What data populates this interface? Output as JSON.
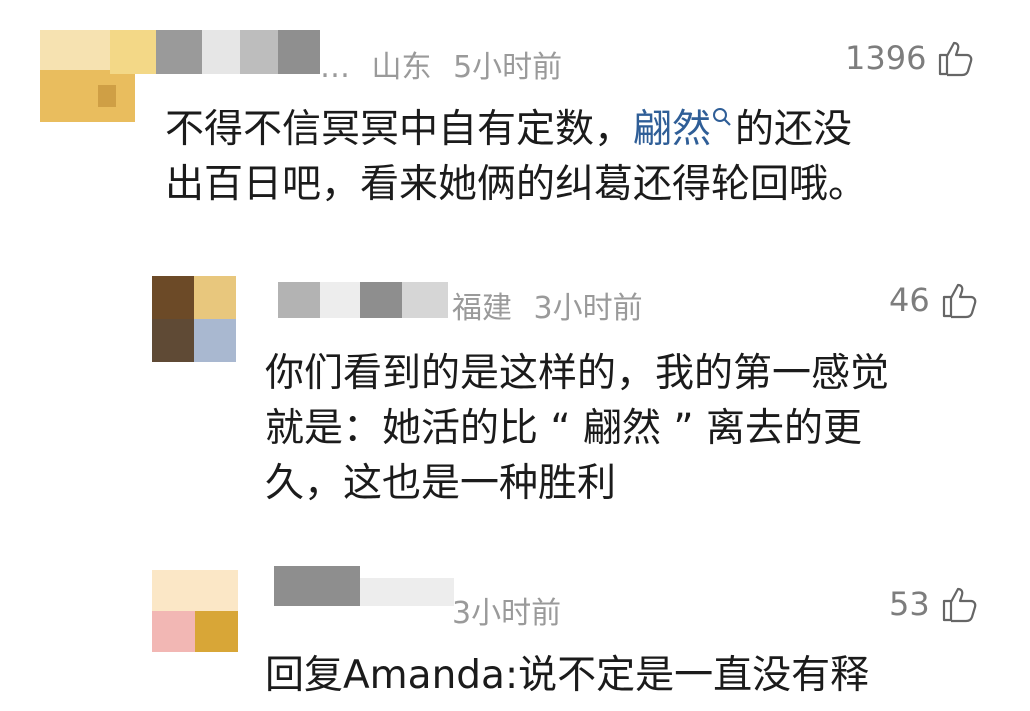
{
  "comments": [
    {
      "name_fragment": "…",
      "location": "山东",
      "time": "5小时前",
      "likes": "1396",
      "text_parts": [
        "不得不信冥冥中自有定数，",
        "翩然",
        "的还没",
        "出百日吧，看来她俩的纠葛还得轮回哦。"
      ],
      "avatar_colors": [
        "#f1c97c",
        "#e9bd5e",
        "#f6e2b1"
      ]
    },
    {
      "location": "福建",
      "time": "3小时前",
      "likes": "46",
      "text_lines": [
        "你们看到的是这样的，我的第一感觉",
        "就是：她活的比 “ 翩然 ” 离去的更",
        "久，这也是一种胜利"
      ],
      "avatar_colors": [
        "#6c4a27",
        "#c9c0b2",
        "#a9b8d0",
        "#e8c77d"
      ]
    },
    {
      "time": "3小时前",
      "likes": "53",
      "text_line": "回复Amanda:说不定是一直没有释",
      "avatar_colors": [
        "#f5e6c4",
        "#f2b7b4",
        "#d8a637",
        "#fbe7c6"
      ]
    }
  ],
  "icons": {
    "like": "thumbs-up-icon",
    "search": "search-icon"
  }
}
